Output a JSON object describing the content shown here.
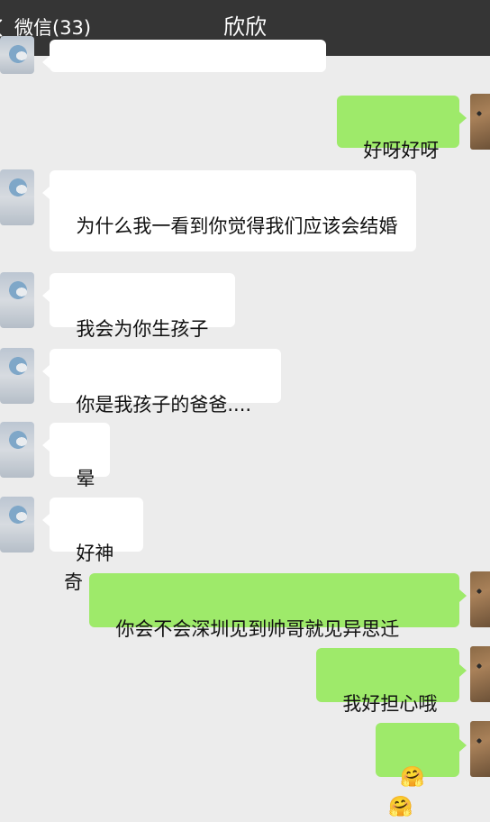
{
  "nav": {
    "back_label": "微信(33)",
    "title": "欣欣"
  },
  "messages": [
    {
      "side": "in",
      "text": ""
    },
    {
      "side": "out",
      "text": "好呀好呀"
    },
    {
      "side": "in",
      "text": "为什么我一看到你觉得我们应该会结婚"
    },
    {
      "side": "in",
      "text": "我会为你生孩子"
    },
    {
      "side": "in",
      "text": "你是我孩子的爸爸...."
    },
    {
      "side": "in",
      "text": "晕"
    },
    {
      "side": "in",
      "text": "好神奇"
    },
    {
      "side": "out",
      "text": "你会不会深圳见到帅哥就见异思迁"
    },
    {
      "side": "out",
      "text": "我好担心哦"
    },
    {
      "side": "out",
      "text": "🤗🤗"
    }
  ],
  "colors": {
    "nav_bg": "#353535",
    "chat_bg": "#ececec",
    "incoming_bubble": "#ffffff",
    "outgoing_bubble": "#9eea6a"
  },
  "icons": {
    "back": "chevron-left-icon",
    "contact_avatar": "cat-avatar",
    "self_avatar": "cat-avatar"
  }
}
